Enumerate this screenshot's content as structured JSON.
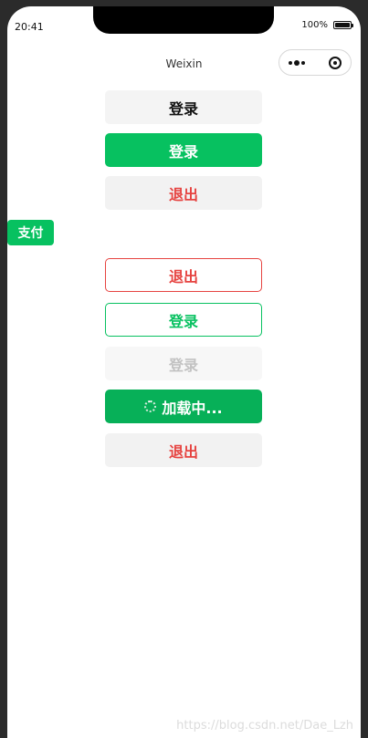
{
  "status": {
    "time": "20:41",
    "battery": "100%"
  },
  "nav": {
    "title": "Weixin"
  },
  "buttons": {
    "login_default": "登录",
    "login_primary": "登录",
    "logout_warn": "退出",
    "pay_mini": "支付",
    "logout_plain": "退出",
    "login_plain": "登录",
    "login_disabled": "登录",
    "loading": "加载中...",
    "logout_bottom": "退出"
  },
  "watermark": "https://blog.csdn.net/Dae_Lzh"
}
